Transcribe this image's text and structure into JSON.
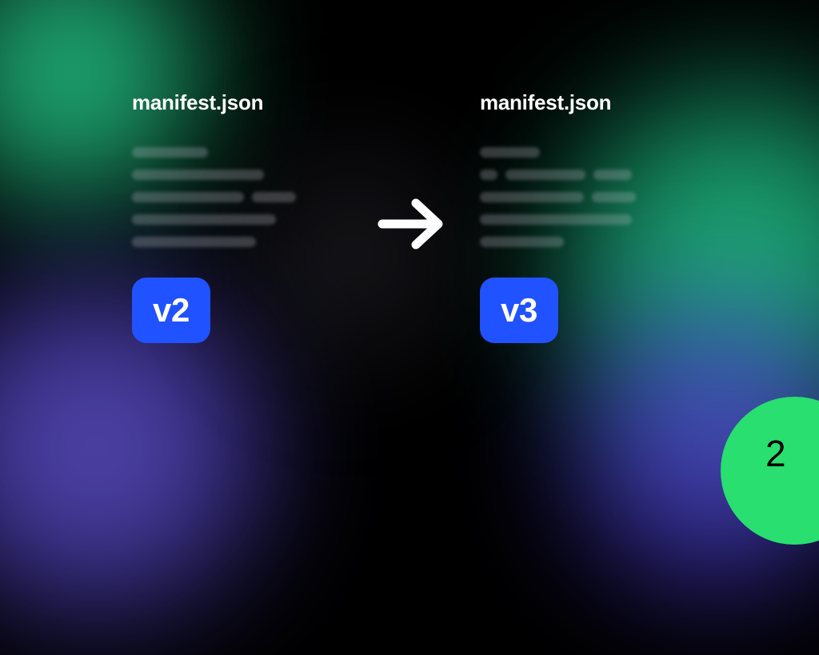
{
  "left": {
    "title": "manifest.json",
    "badge": "v2",
    "skeleton_rows": [
      [
        95
      ],
      [
        165
      ],
      [
        140,
        55
      ],
      [
        180
      ],
      [
        155
      ]
    ]
  },
  "right": {
    "title": "manifest.json",
    "badge": "v3",
    "skeleton_rows": [
      [
        75
      ],
      [
        22,
        100,
        48
      ],
      [
        130,
        55
      ],
      [
        190
      ],
      [
        105
      ]
    ]
  },
  "page_number": "2",
  "colors": {
    "badge_bg": "#2152ff",
    "accent_green": "#28df70"
  }
}
